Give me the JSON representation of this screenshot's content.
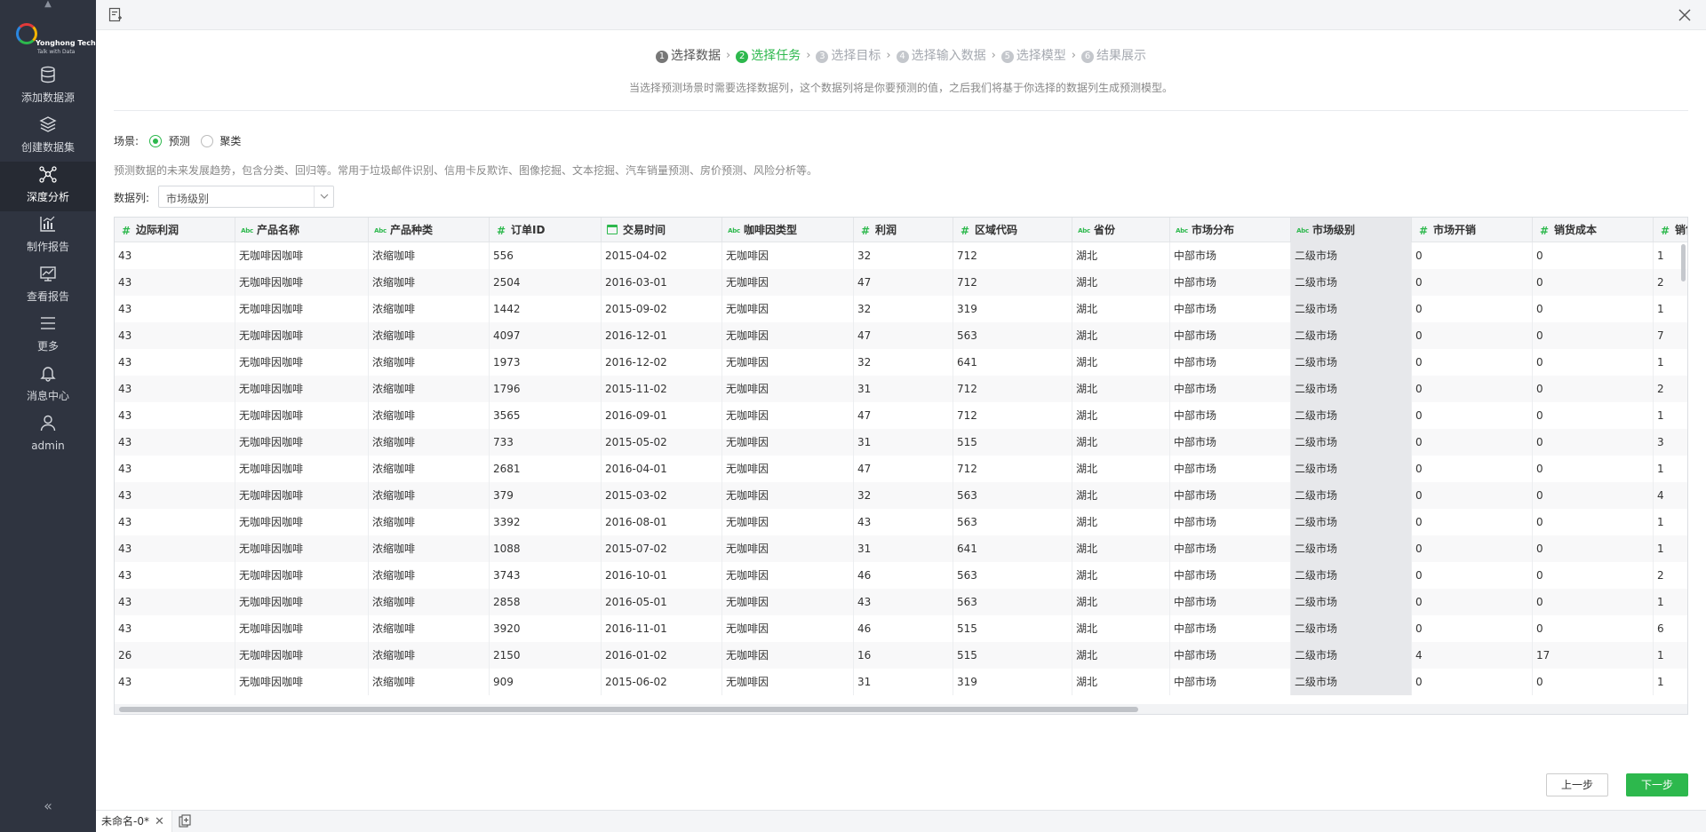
{
  "sidebar": {
    "logo_name": "Yonghong Tech",
    "logo_tagline": "Talk with Data",
    "items": [
      {
        "icon": "database-icon",
        "label": "添加数据源"
      },
      {
        "icon": "layers-icon",
        "label": "创建数据集"
      },
      {
        "icon": "network-icon",
        "label": "深度分析"
      },
      {
        "icon": "bar-chart-icon",
        "label": "制作报告"
      },
      {
        "icon": "line-chart-icon",
        "label": "查看报告"
      },
      {
        "icon": "menu-icon",
        "label": "更多"
      },
      {
        "icon": "bell-icon",
        "label": "消息中心"
      },
      {
        "icon": "user-icon",
        "label": "admin"
      }
    ],
    "active_index": 2,
    "collapse_glyph": "«"
  },
  "steps": [
    {
      "num": "1",
      "label": "选择数据",
      "state": "done"
    },
    {
      "num": "2",
      "label": "选择任务",
      "state": "current"
    },
    {
      "num": "3",
      "label": "选择目标",
      "state": "todo"
    },
    {
      "num": "4",
      "label": "选择输入数据",
      "state": "todo"
    },
    {
      "num": "5",
      "label": "选择模型",
      "state": "todo"
    },
    {
      "num": "6",
      "label": "结果展示",
      "state": "todo"
    }
  ],
  "step_hint": "当选择预测场景时需要选择数据列，这个数据列将是你要预测的值，之后我们将基于你选择的数据列生成预测模型。",
  "scene": {
    "label": "场景:",
    "options": [
      "预测",
      "聚类"
    ],
    "selected": 0,
    "description": "预测数据的未来发展趋势，包含分类、回归等。常用于垃圾邮件识别、信用卡反欺诈、图像挖掘、文本挖掘、汽车销量预测、房价预测、风险分析等。"
  },
  "column": {
    "label": "数据列:",
    "value": "市场级别"
  },
  "table": {
    "columns": [
      {
        "name": "边际利润",
        "type": "number"
      },
      {
        "name": "产品名称",
        "type": "text"
      },
      {
        "name": "产品种类",
        "type": "text"
      },
      {
        "name": "订单ID",
        "type": "number"
      },
      {
        "name": "交易时间",
        "type": "date"
      },
      {
        "name": "咖啡因类型",
        "type": "text"
      },
      {
        "name": "利润",
        "type": "number"
      },
      {
        "name": "区域代码",
        "type": "number"
      },
      {
        "name": "省份",
        "type": "text"
      },
      {
        "name": "市场分布",
        "type": "text"
      },
      {
        "name": "市场级别",
        "type": "text"
      },
      {
        "name": "市场开销",
        "type": "number"
      },
      {
        "name": "销货成本",
        "type": "number"
      },
      {
        "name": "销售",
        "type": "number"
      }
    ],
    "selected_column": 10,
    "rows": [
      [
        "43",
        "无咖啡因咖啡",
        "浓缩咖啡",
        "556",
        "2015-04-02",
        "无咖啡因",
        "32",
        "712",
        "湖北",
        "中部市场",
        "二级市场",
        "0",
        "0",
        "1"
      ],
      [
        "43",
        "无咖啡因咖啡",
        "浓缩咖啡",
        "2504",
        "2016-03-01",
        "无咖啡因",
        "47",
        "712",
        "湖北",
        "中部市场",
        "二级市场",
        "0",
        "0",
        "2"
      ],
      [
        "43",
        "无咖啡因咖啡",
        "浓缩咖啡",
        "1442",
        "2015-09-02",
        "无咖啡因",
        "32",
        "319",
        "湖北",
        "中部市场",
        "二级市场",
        "0",
        "0",
        "1"
      ],
      [
        "43",
        "无咖啡因咖啡",
        "浓缩咖啡",
        "4097",
        "2016-12-01",
        "无咖啡因",
        "47",
        "563",
        "湖北",
        "中部市场",
        "二级市场",
        "0",
        "0",
        "7"
      ],
      [
        "43",
        "无咖啡因咖啡",
        "浓缩咖啡",
        "1973",
        "2016-12-02",
        "无咖啡因",
        "32",
        "641",
        "湖北",
        "中部市场",
        "二级市场",
        "0",
        "0",
        "1"
      ],
      [
        "43",
        "无咖啡因咖啡",
        "浓缩咖啡",
        "1796",
        "2015-11-02",
        "无咖啡因",
        "31",
        "712",
        "湖北",
        "中部市场",
        "二级市场",
        "0",
        "0",
        "2"
      ],
      [
        "43",
        "无咖啡因咖啡",
        "浓缩咖啡",
        "3565",
        "2016-09-01",
        "无咖啡因",
        "47",
        "712",
        "湖北",
        "中部市场",
        "二级市场",
        "0",
        "0",
        "1"
      ],
      [
        "43",
        "无咖啡因咖啡",
        "浓缩咖啡",
        "733",
        "2015-05-02",
        "无咖啡因",
        "31",
        "515",
        "湖北",
        "中部市场",
        "二级市场",
        "0",
        "0",
        "3"
      ],
      [
        "43",
        "无咖啡因咖啡",
        "浓缩咖啡",
        "2681",
        "2016-04-01",
        "无咖啡因",
        "47",
        "712",
        "湖北",
        "中部市场",
        "二级市场",
        "0",
        "0",
        "1"
      ],
      [
        "43",
        "无咖啡因咖啡",
        "浓缩咖啡",
        "379",
        "2015-03-02",
        "无咖啡因",
        "32",
        "563",
        "湖北",
        "中部市场",
        "二级市场",
        "0",
        "0",
        "4"
      ],
      [
        "43",
        "无咖啡因咖啡",
        "浓缩咖啡",
        "3392",
        "2016-08-01",
        "无咖啡因",
        "43",
        "563",
        "湖北",
        "中部市场",
        "二级市场",
        "0",
        "0",
        "1"
      ],
      [
        "43",
        "无咖啡因咖啡",
        "浓缩咖啡",
        "1088",
        "2015-07-02",
        "无咖啡因",
        "31",
        "641",
        "湖北",
        "中部市场",
        "二级市场",
        "0",
        "0",
        "1"
      ],
      [
        "43",
        "无咖啡因咖啡",
        "浓缩咖啡",
        "3743",
        "2016-10-01",
        "无咖啡因",
        "46",
        "563",
        "湖北",
        "中部市场",
        "二级市场",
        "0",
        "0",
        "2"
      ],
      [
        "43",
        "无咖啡因咖啡",
        "浓缩咖啡",
        "2858",
        "2016-05-01",
        "无咖啡因",
        "43",
        "563",
        "湖北",
        "中部市场",
        "二级市场",
        "0",
        "0",
        "1"
      ],
      [
        "43",
        "无咖啡因咖啡",
        "浓缩咖啡",
        "3920",
        "2016-11-01",
        "无咖啡因",
        "46",
        "515",
        "湖北",
        "中部市场",
        "二级市场",
        "0",
        "0",
        "6"
      ],
      [
        "26",
        "无咖啡因咖啡",
        "浓缩咖啡",
        "2150",
        "2016-01-02",
        "无咖啡因",
        "16",
        "515",
        "湖北",
        "中部市场",
        "二级市场",
        "4",
        "17",
        "1"
      ],
      [
        "43",
        "无咖啡因咖啡",
        "浓缩咖啡",
        "909",
        "2015-06-02",
        "无咖啡因",
        "31",
        "319",
        "湖北",
        "中部市场",
        "二级市场",
        "0",
        "0",
        "1"
      ]
    ]
  },
  "buttons": {
    "prev": "上一步",
    "next": "下一步"
  },
  "tabs": [
    {
      "label": "未命名-0*"
    }
  ],
  "colors": {
    "accent": "#2db84d",
    "sidebar": "#2f3440",
    "selected_column": "#e7e8eb"
  }
}
